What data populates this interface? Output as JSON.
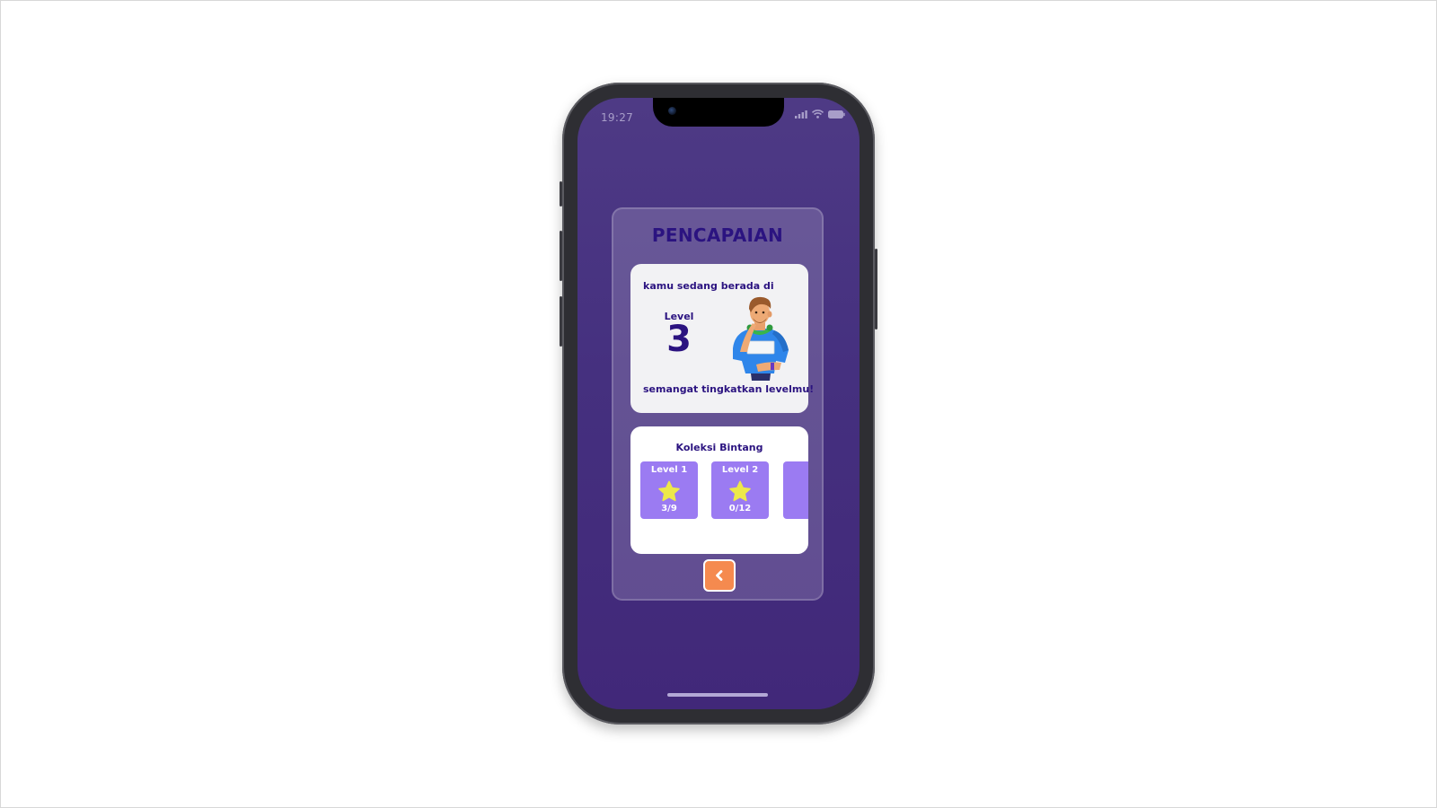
{
  "status_bar": {
    "time": "19:27",
    "icons": [
      "signal-icon",
      "wifi-icon",
      "battery-icon"
    ]
  },
  "achievement": {
    "title": "PENCAPAIAN",
    "level_card": {
      "intro": "kamu sedang berada di",
      "level_label": "Level",
      "level_number": "3",
      "encouragement": "semangat tingkatkan levelmu!"
    },
    "star_collection": {
      "title": "Koleksi Bintang",
      "levels": [
        {
          "label": "Level 1",
          "count": "3/9"
        },
        {
          "label": "Level 2",
          "count": "0/12"
        }
      ]
    },
    "back_icon": "chevron-left-icon"
  },
  "colors": {
    "screen_bg": "#45307f",
    "title_text": "#2b1380",
    "tile_bg": "#9b7bf2",
    "star": "#ede84a",
    "back_button": "#f58a4f"
  }
}
